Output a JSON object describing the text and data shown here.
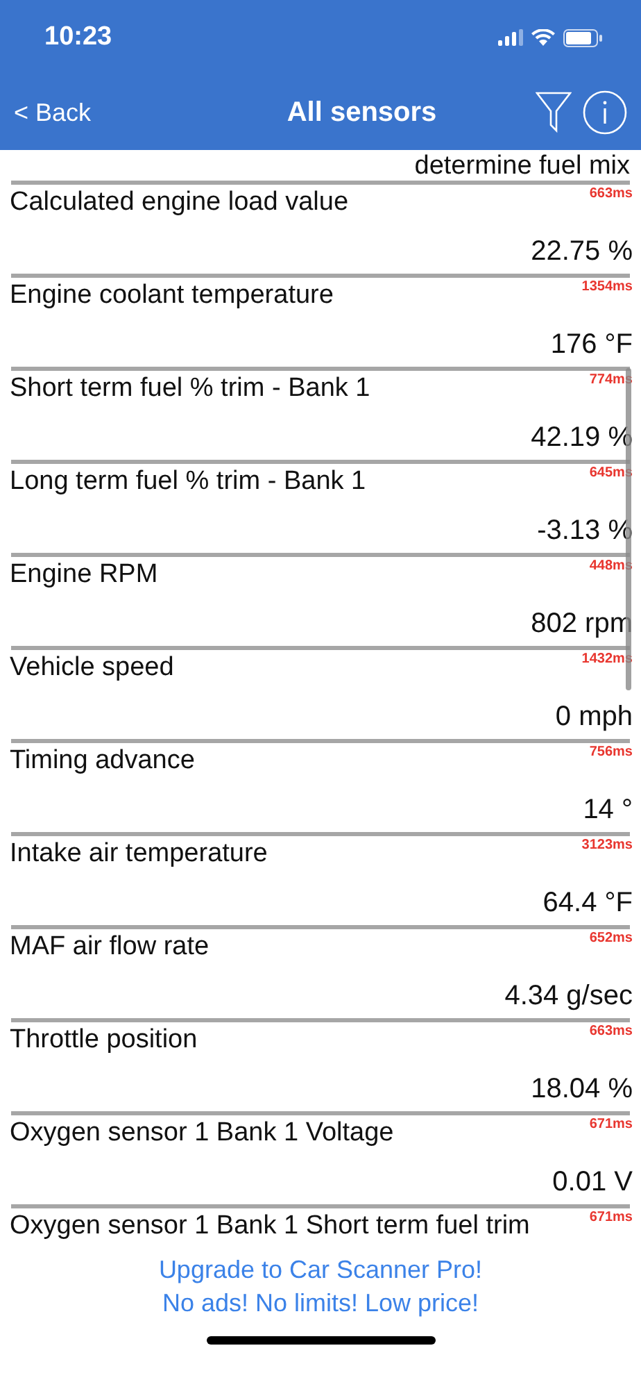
{
  "status_bar": {
    "time": "10:23"
  },
  "nav": {
    "back": "< Back",
    "title": "All sensors"
  },
  "partial_value": "determine fuel mix",
  "sensors": [
    {
      "name": "Calculated engine load value",
      "latency": "663ms",
      "value": "22.75 %"
    },
    {
      "name": "Engine coolant temperature",
      "latency": "1354ms",
      "value": "176 °F"
    },
    {
      "name": "Short term fuel % trim - Bank 1",
      "latency": "774ms",
      "value": "42.19 %"
    },
    {
      "name": "Long term fuel % trim - Bank 1",
      "latency": "645ms",
      "value": "-3.13 %"
    },
    {
      "name": "Engine RPM",
      "latency": "448ms",
      "value": "802 rpm"
    },
    {
      "name": "Vehicle speed",
      "latency": "1432ms",
      "value": "0 mph"
    },
    {
      "name": "Timing advance",
      "latency": "756ms",
      "value": "14 °"
    },
    {
      "name": "Intake air temperature",
      "latency": "3123ms",
      "value": "64.4 °F"
    },
    {
      "name": "MAF air flow rate",
      "latency": "652ms",
      "value": "4.34 g/sec"
    },
    {
      "name": "Throttle position",
      "latency": "663ms",
      "value": "18.04 %"
    },
    {
      "name": "Oxygen sensor 1 Bank 1 Voltage",
      "latency": "671ms",
      "value": "0.01 V"
    },
    {
      "name": "Oxygen sensor 1 Bank 1 Short term fuel trim",
      "latency": "671ms"
    }
  ],
  "promo": [
    "Upgrade to Car Scanner Pro!",
    "No ads! No limits! Low price!"
  ]
}
